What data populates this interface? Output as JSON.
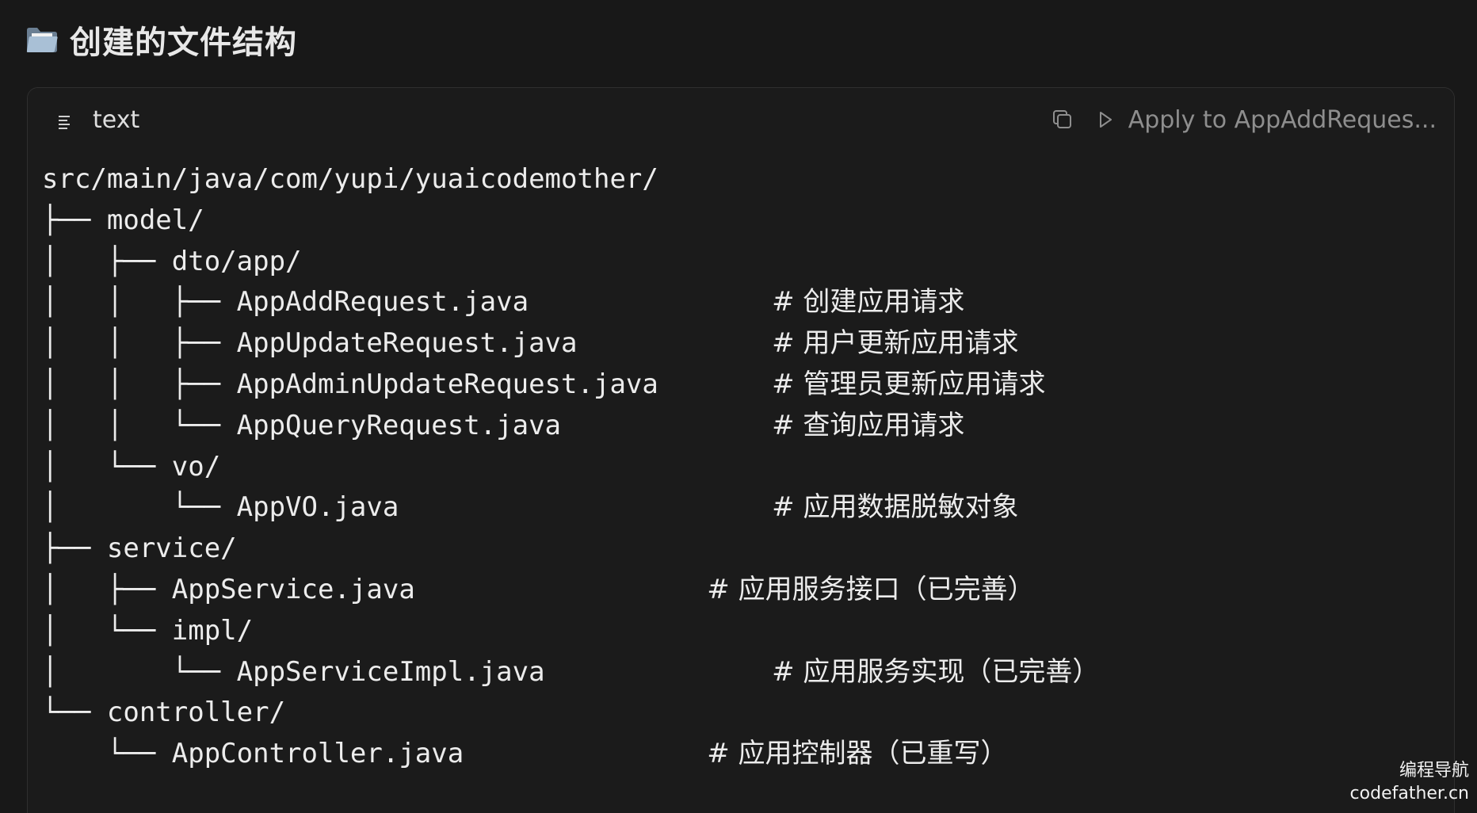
{
  "heading": {
    "icon": "folder-icon",
    "title": "创建的文件结构"
  },
  "code_block": {
    "language": "text",
    "language_icon": "lines-icon",
    "copy_icon": "copy-icon",
    "apply_icon": "play-icon",
    "apply_label": "Apply to AppAddReques...",
    "lines": [
      {
        "tree": "src/main/java/com/yupi/yuaicodemother/",
        "comment": ""
      },
      {
        "tree": "├── model/",
        "comment": ""
      },
      {
        "tree": "│   ├── dto/app/",
        "comment": ""
      },
      {
        "tree": "│   │   ├── AppAddRequest.java",
        "comment": "# 创建应用请求"
      },
      {
        "tree": "│   │   ├── AppUpdateRequest.java",
        "comment": "# 用户更新应用请求"
      },
      {
        "tree": "│   │   ├── AppAdminUpdateRequest.java",
        "comment": "# 管理员更新应用请求"
      },
      {
        "tree": "│   │   └── AppQueryRequest.java",
        "comment": "# 查询应用请求"
      },
      {
        "tree": "│   └── vo/",
        "comment": ""
      },
      {
        "tree": "│       └── AppVO.java",
        "comment": "# 应用数据脱敏对象"
      },
      {
        "tree": "├── service/",
        "comment": ""
      },
      {
        "tree": "│   ├── AppService.java",
        "comment": "# 应用服务接口（已完善）"
      },
      {
        "tree": "│   └── impl/",
        "comment": ""
      },
      {
        "tree": "│       └── AppServiceImpl.java",
        "comment": "# 应用服务实现（已完善）"
      },
      {
        "tree": "└── controller/",
        "comment": ""
      },
      {
        "tree": "    └── AppController.java",
        "comment": "# 应用控制器（已重写）"
      }
    ]
  },
  "watermark": {
    "line1": "编程导航",
    "line2": "codefather.cn"
  }
}
